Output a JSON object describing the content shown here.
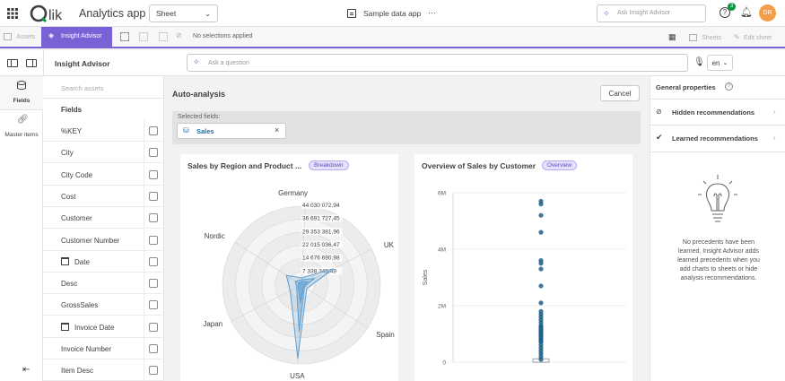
{
  "topbar": {
    "logo": "Qlik",
    "app_label": "Analytics app",
    "sheet_select": "Sheet",
    "app_name": "Sample data app",
    "more": "···",
    "search_placeholder": "Ask Insight Advisor",
    "notif_count": "3",
    "avatar_initials": "DR"
  },
  "toolbar": {
    "assets": "Assets",
    "insight_advisor": "Insight Advisor",
    "no_selections": "No selections applied",
    "sheets": "Sheets",
    "edit_sheet": "Edit sheet"
  },
  "iabar": {
    "title": "Insight Advisor",
    "question_placeholder": "Ask a question",
    "lang": "en"
  },
  "leftrail": {
    "fields": "Fields",
    "master_items": "Master items"
  },
  "assets": {
    "search_placeholder": "Search assets",
    "header": "Fields",
    "items": [
      {
        "label": "%KEY",
        "date": false
      },
      {
        "label": "City",
        "date": false
      },
      {
        "label": "City Code",
        "date": false
      },
      {
        "label": "Cost",
        "date": false
      },
      {
        "label": "Customer",
        "date": false
      },
      {
        "label": "Customer Number",
        "date": false
      },
      {
        "label": "Date",
        "date": true
      },
      {
        "label": "Desc",
        "date": false
      },
      {
        "label": "GrossSales",
        "date": false
      },
      {
        "label": "Invoice Date",
        "date": true
      },
      {
        "label": "Invoice Number",
        "date": false
      },
      {
        "label": "Item Desc",
        "date": false
      }
    ]
  },
  "main": {
    "title": "Auto-analysis",
    "cancel": "Cancel",
    "selected_label": "Selected fields:",
    "selected_chip": "Sales"
  },
  "charts": {
    "radar": {
      "title": "Sales by Region and Product ...",
      "badge": "Breakdown"
    },
    "box": {
      "title": "Overview of Sales by Customer",
      "badge": "Overview"
    }
  },
  "rpanel": {
    "title": "General properties",
    "hidden": "Hidden recommendations",
    "learned": "Learned recommendations",
    "empty_text": "No precedents have been learned. Insight Advisor adds learned precedents when you add charts to sheets or hide analysis recommendations."
  },
  "colors": {
    "accent": "#7b61d6",
    "qlik_green": "#009845",
    "series": "#1f5f8b",
    "radar_fill": "#4a90c8"
  },
  "chart_data": [
    {
      "type": "radar",
      "title": "Sales by Region and Product ...",
      "categories": [
        "Germany",
        "UK",
        "Spain",
        "USA",
        "Japan",
        "Nordic"
      ],
      "ticks": [
        "44 030 072,94",
        "36 691 727,45",
        "29 353 381,96",
        "22 015 036,47",
        "14 676 690,98",
        "7 338 345,49"
      ],
      "rmax": 44030072.94,
      "series": [
        {
          "values": [
            4000000,
            20000000,
            3500000,
            41000000,
            7000000,
            10000000
          ]
        },
        {
          "values": [
            3000000,
            8000000,
            2000000,
            26000000,
            3000000,
            4000000
          ]
        },
        {
          "values": [
            2000000,
            4000000,
            1500000,
            10000000,
            2000000,
            2000000
          ]
        }
      ]
    },
    {
      "type": "scatter",
      "title": "Overview of Sales by Customer",
      "ylabel": "Sales",
      "yticks": [
        "6M",
        "4M",
        "2M",
        "0"
      ],
      "ylim": [
        0,
        6000000
      ],
      "values": [
        5700000,
        5600000,
        5200000,
        4600000,
        3600000,
        3500000,
        3300000,
        2700000,
        2100000,
        1800000,
        1700000,
        1600000,
        1500000,
        1400000,
        1300000,
        1250000,
        1200000,
        1150000,
        1100000,
        1050000,
        1000000,
        950000,
        900000,
        850000,
        800000,
        750000,
        700000,
        600000,
        500000,
        400000,
        300000,
        200000,
        100000
      ]
    }
  ]
}
